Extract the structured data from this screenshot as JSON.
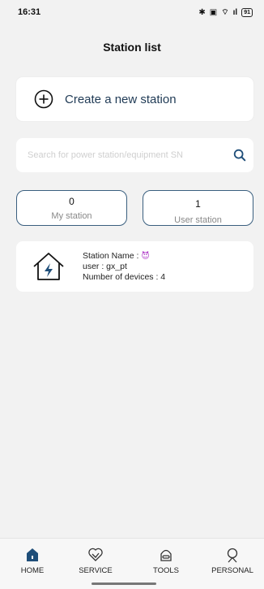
{
  "status_bar": {
    "time": "16:31",
    "bluetooth": "✱",
    "nfc": "▣",
    "wifi": "⌔",
    "signal": "ıl",
    "battery": "91"
  },
  "header": {
    "title": "Station list"
  },
  "create": {
    "label": "Create a new station",
    "icon": "plus-circle-icon"
  },
  "search": {
    "placeholder": "Search for power station/equipment SN",
    "value": "",
    "icon": "search-icon"
  },
  "tabs": [
    {
      "count": "0",
      "label": "My station",
      "selected": false
    },
    {
      "count": "1",
      "label": "User station",
      "selected": true
    }
  ],
  "stations": [
    {
      "name_label": "Station Name : ",
      "name_value": "😈",
      "user_label": "user : gx_pt",
      "devices_label": "Number of devices : 4",
      "icon": "house-bolt-icon"
    }
  ],
  "nav": [
    {
      "label": "HOME",
      "icon": "home-icon",
      "active": true
    },
    {
      "label": "SERVICE",
      "icon": "service-icon",
      "active": false
    },
    {
      "label": "TOOLS",
      "icon": "tools-icon",
      "active": false
    },
    {
      "label": "PERSONAL",
      "icon": "personal-icon",
      "active": false
    }
  ],
  "colors": {
    "accent": "#1f4e79",
    "background": "#f2f2f2",
    "card": "#ffffff"
  }
}
